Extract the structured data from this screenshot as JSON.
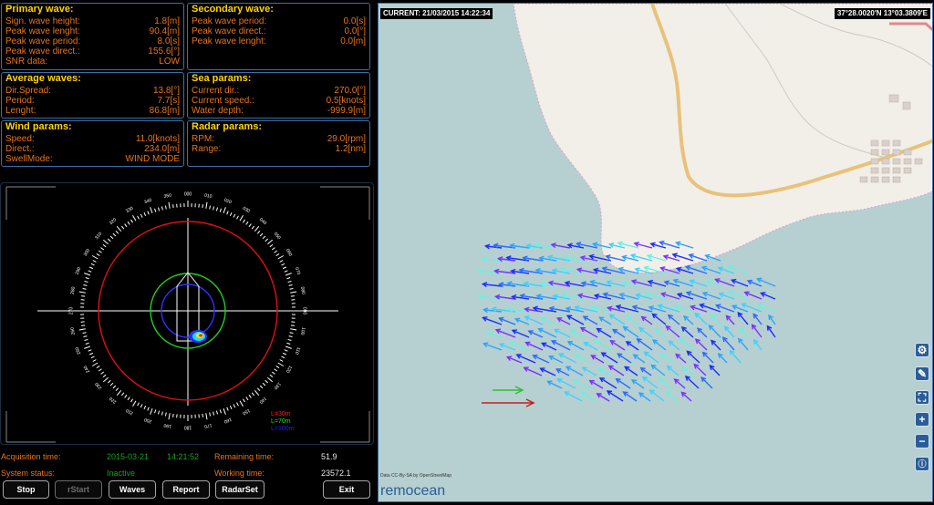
{
  "primary": {
    "title": "Primary wave:",
    "rows": [
      {
        "label": "Sign. wave height:",
        "value": "1.8[m]"
      },
      {
        "label": "Peak wave lenght:",
        "value": "90.4[m]"
      },
      {
        "label": "Peak wave period:",
        "value": "8.0[s]"
      },
      {
        "label": "Peak wave direct.:",
        "value": "155.6[°]"
      },
      {
        "label": "SNR data:",
        "value": "LOW"
      }
    ]
  },
  "secondary": {
    "title": "Secondary wave:",
    "rows": [
      {
        "label": "Peak wave period:",
        "value": "0.0[s]"
      },
      {
        "label": "Peak wave direct.:",
        "value": "0.0[°]"
      },
      {
        "label": "Peak wave lenght:",
        "value": "0.0[m]"
      }
    ]
  },
  "average": {
    "title": "Average waves:",
    "rows": [
      {
        "label": "Dir.Spread:",
        "value": "13.8[°]"
      },
      {
        "label": "Period:",
        "value": "7.7[s]"
      },
      {
        "label": "Lenght:",
        "value": "86.8[m]"
      }
    ]
  },
  "sea": {
    "title": "Sea params:",
    "rows": [
      {
        "label": "Current dir.:",
        "value": "270.0[°]"
      },
      {
        "label": "Current speed.:",
        "value": "0.5[knots]"
      },
      {
        "label": "Water depth:",
        "value": "-999.9[m]"
      }
    ]
  },
  "wind": {
    "title": "Wind params:",
    "rows": [
      {
        "label": "Speed:",
        "value": "11.0[knots]"
      },
      {
        "label": "Direct.:",
        "value": "234.0[m]"
      },
      {
        "label": "SwellMode:",
        "value": "WIND MODE"
      }
    ]
  },
  "radar": {
    "title": "Radar params:",
    "rows": [
      {
        "label": "RPM:",
        "value": "29.0[rpm]"
      },
      {
        "label": "Range:",
        "value": "1.2[nm]"
      }
    ]
  },
  "polar": {
    "legend": [
      "L=30m",
      "L=70m",
      "L=100m"
    ],
    "legend_colors": [
      "#ff2020",
      "#20e020",
      "#2020ff"
    ]
  },
  "status": {
    "acq_label": "Acquisition time:",
    "acq_date": "2015-03-21",
    "acq_time": "14:21:52",
    "remaining_label": "Remaining time:",
    "remaining_value": "51.9",
    "system_label": "System status:",
    "system_value": "Inactive",
    "working_label": "Working time:",
    "working_value": "23572.1"
  },
  "buttons": {
    "stop": "Stop",
    "rstart": "rStart",
    "waves": "Waves",
    "report": "Report",
    "radarset": "RadarSet",
    "exit": "Exit"
  },
  "map": {
    "current": "CURRENT: 21/03/2015 14:22:34",
    "coords": "37°28.0020'N 13°03.3809'E",
    "credit": "Data CC-By-SA by OpenStreetMap",
    "brand": "remocean",
    "zoom_in": "+",
    "zoom_out": "−",
    "colors": {
      "sea": "#b6d0d1",
      "land": "#f2efe9",
      "road": "#e8c27a"
    }
  }
}
